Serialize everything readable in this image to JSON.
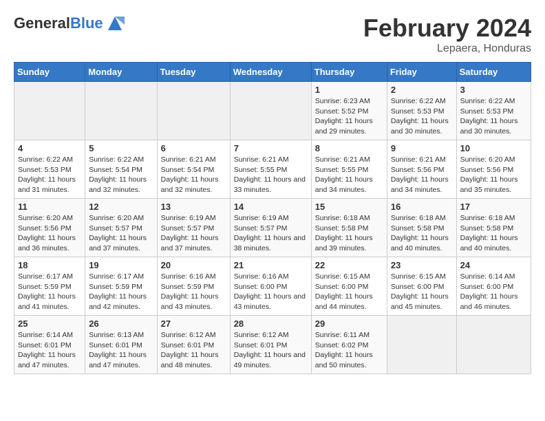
{
  "header": {
    "logo_text_general": "General",
    "logo_text_blue": "Blue",
    "month_title": "February 2024",
    "subtitle": "Lepaera, Honduras"
  },
  "days_of_week": [
    "Sunday",
    "Monday",
    "Tuesday",
    "Wednesday",
    "Thursday",
    "Friday",
    "Saturday"
  ],
  "weeks": [
    [
      {
        "day": "",
        "info": ""
      },
      {
        "day": "",
        "info": ""
      },
      {
        "day": "",
        "info": ""
      },
      {
        "day": "",
        "info": ""
      },
      {
        "day": "1",
        "info": "Sunrise: 6:23 AM\nSunset: 5:52 PM\nDaylight: 11 hours and 29 minutes."
      },
      {
        "day": "2",
        "info": "Sunrise: 6:22 AM\nSunset: 5:53 PM\nDaylight: 11 hours and 30 minutes."
      },
      {
        "day": "3",
        "info": "Sunrise: 6:22 AM\nSunset: 5:53 PM\nDaylight: 11 hours and 30 minutes."
      }
    ],
    [
      {
        "day": "4",
        "info": "Sunrise: 6:22 AM\nSunset: 5:53 PM\nDaylight: 11 hours and 31 minutes."
      },
      {
        "day": "5",
        "info": "Sunrise: 6:22 AM\nSunset: 5:54 PM\nDaylight: 11 hours and 32 minutes."
      },
      {
        "day": "6",
        "info": "Sunrise: 6:21 AM\nSunset: 5:54 PM\nDaylight: 11 hours and 32 minutes."
      },
      {
        "day": "7",
        "info": "Sunrise: 6:21 AM\nSunset: 5:55 PM\nDaylight: 11 hours and 33 minutes."
      },
      {
        "day": "8",
        "info": "Sunrise: 6:21 AM\nSunset: 5:55 PM\nDaylight: 11 hours and 34 minutes."
      },
      {
        "day": "9",
        "info": "Sunrise: 6:21 AM\nSunset: 5:56 PM\nDaylight: 11 hours and 34 minutes."
      },
      {
        "day": "10",
        "info": "Sunrise: 6:20 AM\nSunset: 5:56 PM\nDaylight: 11 hours and 35 minutes."
      }
    ],
    [
      {
        "day": "11",
        "info": "Sunrise: 6:20 AM\nSunset: 5:56 PM\nDaylight: 11 hours and 36 minutes."
      },
      {
        "day": "12",
        "info": "Sunrise: 6:20 AM\nSunset: 5:57 PM\nDaylight: 11 hours and 37 minutes."
      },
      {
        "day": "13",
        "info": "Sunrise: 6:19 AM\nSunset: 5:57 PM\nDaylight: 11 hours and 37 minutes."
      },
      {
        "day": "14",
        "info": "Sunrise: 6:19 AM\nSunset: 5:57 PM\nDaylight: 11 hours and 38 minutes."
      },
      {
        "day": "15",
        "info": "Sunrise: 6:18 AM\nSunset: 5:58 PM\nDaylight: 11 hours and 39 minutes."
      },
      {
        "day": "16",
        "info": "Sunrise: 6:18 AM\nSunset: 5:58 PM\nDaylight: 11 hours and 40 minutes."
      },
      {
        "day": "17",
        "info": "Sunrise: 6:18 AM\nSunset: 5:58 PM\nDaylight: 11 hours and 40 minutes."
      }
    ],
    [
      {
        "day": "18",
        "info": "Sunrise: 6:17 AM\nSunset: 5:59 PM\nDaylight: 11 hours and 41 minutes."
      },
      {
        "day": "19",
        "info": "Sunrise: 6:17 AM\nSunset: 5:59 PM\nDaylight: 11 hours and 42 minutes."
      },
      {
        "day": "20",
        "info": "Sunrise: 6:16 AM\nSunset: 5:59 PM\nDaylight: 11 hours and 43 minutes."
      },
      {
        "day": "21",
        "info": "Sunrise: 6:16 AM\nSunset: 6:00 PM\nDaylight: 11 hours and 43 minutes."
      },
      {
        "day": "22",
        "info": "Sunrise: 6:15 AM\nSunset: 6:00 PM\nDaylight: 11 hours and 44 minutes."
      },
      {
        "day": "23",
        "info": "Sunrise: 6:15 AM\nSunset: 6:00 PM\nDaylight: 11 hours and 45 minutes."
      },
      {
        "day": "24",
        "info": "Sunrise: 6:14 AM\nSunset: 6:00 PM\nDaylight: 11 hours and 46 minutes."
      }
    ],
    [
      {
        "day": "25",
        "info": "Sunrise: 6:14 AM\nSunset: 6:01 PM\nDaylight: 11 hours and 47 minutes."
      },
      {
        "day": "26",
        "info": "Sunrise: 6:13 AM\nSunset: 6:01 PM\nDaylight: 11 hours and 47 minutes."
      },
      {
        "day": "27",
        "info": "Sunrise: 6:12 AM\nSunset: 6:01 PM\nDaylight: 11 hours and 48 minutes."
      },
      {
        "day": "28",
        "info": "Sunrise: 6:12 AM\nSunset: 6:01 PM\nDaylight: 11 hours and 49 minutes."
      },
      {
        "day": "29",
        "info": "Sunrise: 6:11 AM\nSunset: 6:02 PM\nDaylight: 11 hours and 50 minutes."
      },
      {
        "day": "",
        "info": ""
      },
      {
        "day": "",
        "info": ""
      }
    ]
  ]
}
